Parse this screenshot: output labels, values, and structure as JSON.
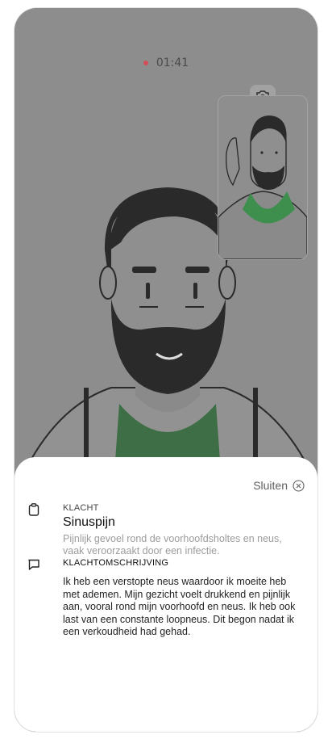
{
  "call": {
    "timer": "01:41"
  },
  "sheet": {
    "close_label": "Sluiten",
    "complaint": {
      "overline": "KLACHT",
      "title": "Sinuspijn",
      "description": "Pijnlijk gevoel rond de voorhoofdsholtes en neus, vaak veroorzaakt door een infectie."
    },
    "description_section": {
      "overline": "KLACHTOMSCHRIJVING",
      "text": "Ik heb een verstopte neus waardoor ik moeite heb met ademen. Mijn gezicht voelt drukkend en pijnlijk aan, vooral rond mijn voorhoofd en neus. Ik heb ook last van een constante loopneus. Dit begon nadat ik een verkoudheid had gehad."
    }
  },
  "icons": {
    "recording": "record-dot-icon",
    "flip_camera": "camera-flip-icon",
    "close": "close-circle-icon",
    "clipboard": "clipboard-icon",
    "chat": "chat-bubble-icon"
  },
  "colors": {
    "overlay": "#8d8d8d",
    "record_dot": "#d24f59",
    "scarf_green": "#3e8e4e",
    "sheet_bg": "#ffffff"
  }
}
